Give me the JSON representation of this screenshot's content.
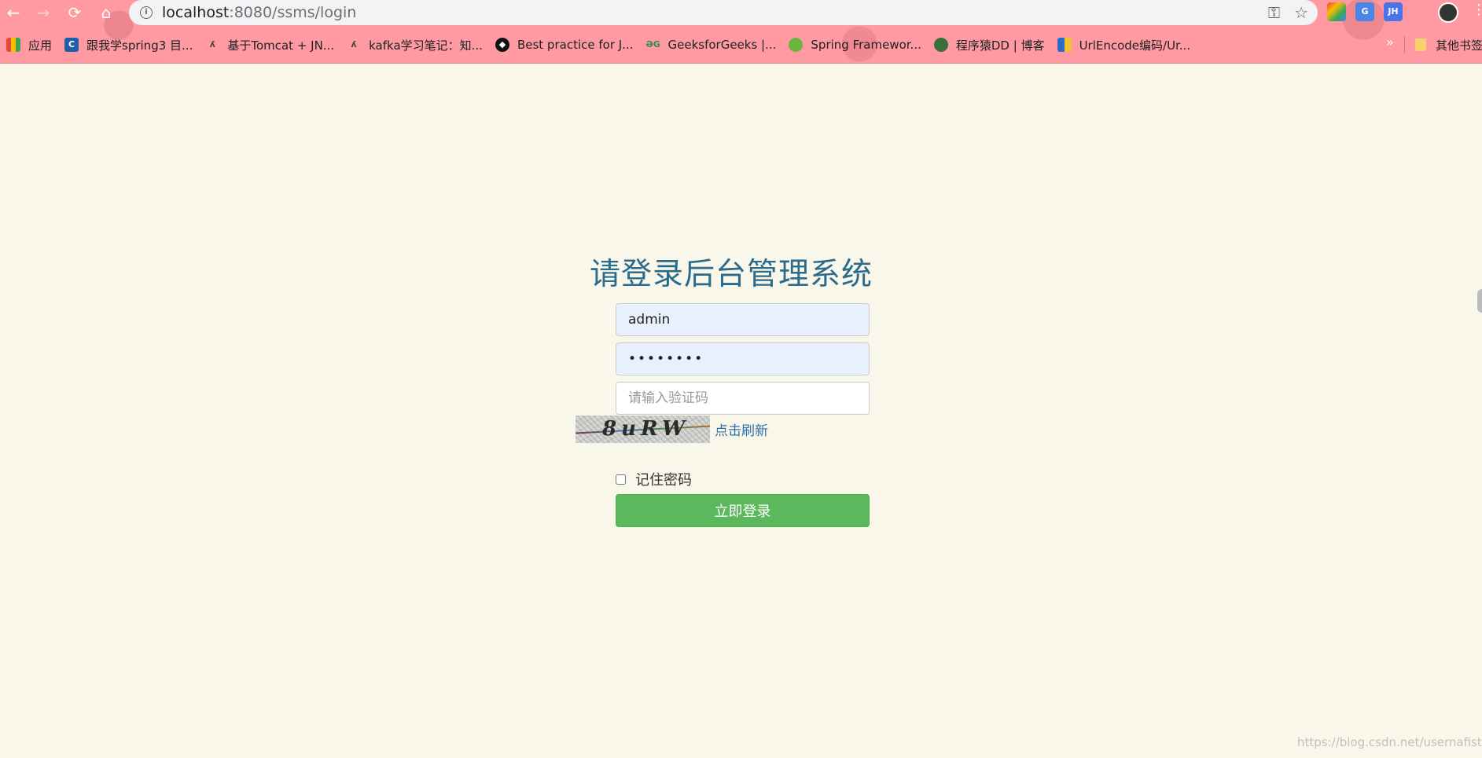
{
  "browser": {
    "url_host": "localhost",
    "url_path": ":8080/ssms/login",
    "extensions": [
      "JH"
    ],
    "bookmarks": [
      {
        "label": "应用",
        "color": "#e8453c"
      },
      {
        "label": "跟我学spring3 目...",
        "color": "#1f5fa8"
      },
      {
        "label": "基于Tomcat + JN...",
        "color": "#555555"
      },
      {
        "label": "kafka学习笔记：知...",
        "color": "#555555"
      },
      {
        "label": "Best practice for J...",
        "color": "#111111"
      },
      {
        "label": "GeeksforGeeks |...",
        "color": "#2f8d46"
      },
      {
        "label": "Spring Framewor...",
        "color": "#6db33f"
      },
      {
        "label": "程序猿DD | 博客",
        "color": "#3c6e3c"
      },
      {
        "label": "UrlEncode编码/Ur...",
        "color": "#2a6ac8"
      }
    ],
    "more_bookmarks": "»",
    "other_bookmarks": "其他书签"
  },
  "login": {
    "title": "请登录后台管理系统",
    "username_value": "admin",
    "password_value": "••••••••",
    "captcha_placeholder": "请输入验证码",
    "captcha_text": "8uRW",
    "refresh_label": "点击刷新",
    "remember_label": "记住密码",
    "submit_label": "立即登录"
  },
  "watermark": "https://blog.csdn.net/usernafister"
}
